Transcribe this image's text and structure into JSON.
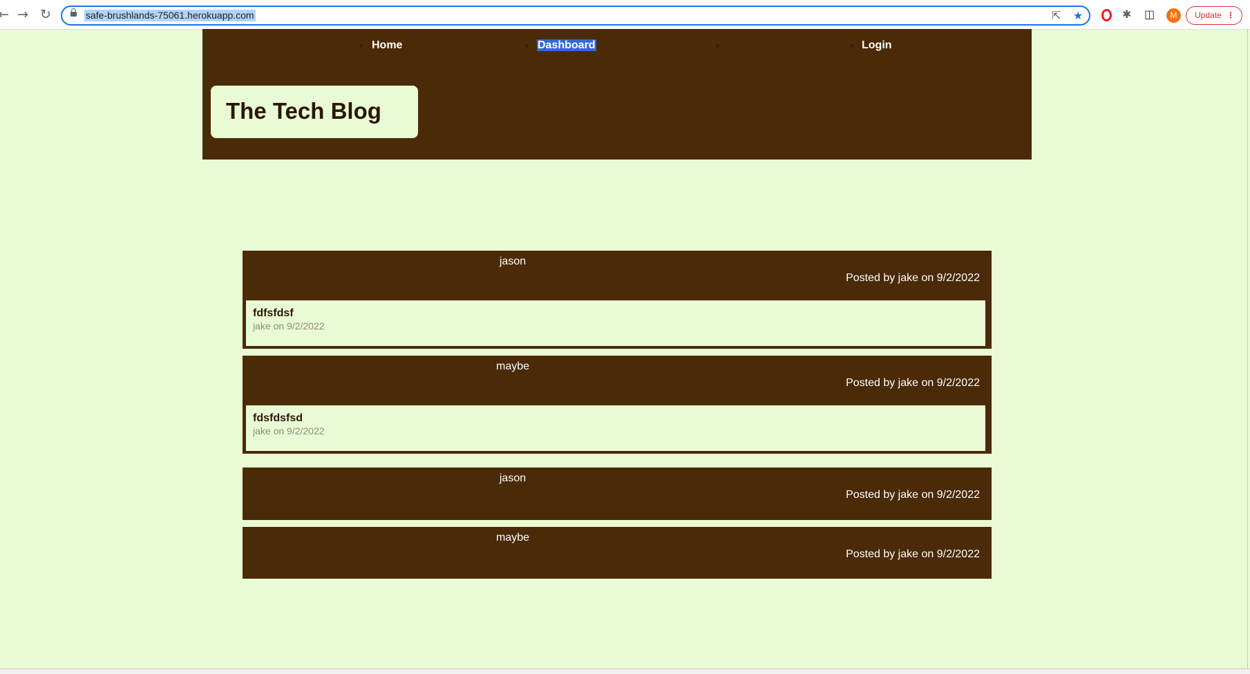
{
  "browser": {
    "url": "safe-brushlands-75061.herokuapp.com",
    "avatar_letter": "M",
    "update_label": "Update",
    "icons": {
      "back": "←",
      "forward": "→",
      "reload": "↻",
      "share": "⇱",
      "star": "★",
      "extensions": "✱",
      "sidebar": "◫",
      "menu": "⋮"
    }
  },
  "site": {
    "nav": {
      "home": "Home",
      "dashboard": "Dashboard",
      "login": "Login"
    },
    "brand": "The Tech Blog"
  },
  "posts": [
    {
      "title": "jason",
      "meta": "Posted by jake on 9/2/2022",
      "comment": {
        "body": "fdfsfdsf",
        "meta": "jake on 9/2/2022"
      }
    },
    {
      "title": "maybe",
      "meta": "Posted by jake on 9/2/2022",
      "comment": {
        "body": "fdsfdsfsd",
        "meta": "jake on 9/2/2022"
      }
    },
    {
      "title": "jason",
      "meta": "Posted by jake on 9/2/2022"
    },
    {
      "title": "maybe",
      "meta": "Posted by jake on 9/2/2022"
    }
  ],
  "colors": {
    "page_bg": "#e9fbd4",
    "brown": "#4a2a07",
    "highlight": "#3367d6"
  }
}
